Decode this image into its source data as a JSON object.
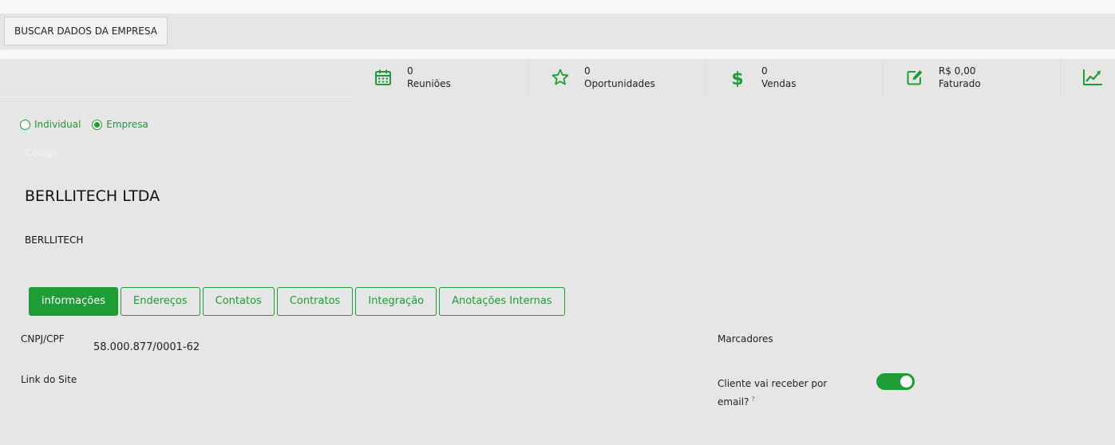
{
  "toolbar": {
    "fetch_button": "BUSCAR DADOS DA EMPRESA"
  },
  "stats": [
    {
      "value": "0",
      "label": "Reuniões",
      "icon": "calendar-icon"
    },
    {
      "value": "0",
      "label": "Oportunidades",
      "icon": "star-icon"
    },
    {
      "value": "0",
      "label": "Vendas",
      "icon": "dollar-icon"
    },
    {
      "value": "R$ 0,00",
      "label": "Faturado",
      "icon": "edit-icon"
    },
    {
      "icon": "trend-chart-icon"
    }
  ],
  "accent_color": "#1e9c35",
  "person_type": {
    "options": [
      "Individual",
      "Empresa"
    ],
    "selected": "Empresa"
  },
  "form": {
    "codigo_placeholder": "Código",
    "company_name": "BERLLITECH LTDA",
    "trade_name": "BERLLITECH"
  },
  "tabs": [
    "informações",
    "Endereços",
    "Contatos",
    "Contratos",
    "Integração",
    "Anotações Internas"
  ],
  "active_tab": "informações",
  "details": {
    "cnpj_label": "CNPJ/CPF",
    "cnpj_value": "58.000.877/0001-62",
    "site_label": "Link do Site",
    "marcadores_label": "Marcadores",
    "email_label_line1": "Cliente vai receber por",
    "email_label_line2": "email?",
    "help_mark": "?",
    "email_toggle_on": true
  }
}
